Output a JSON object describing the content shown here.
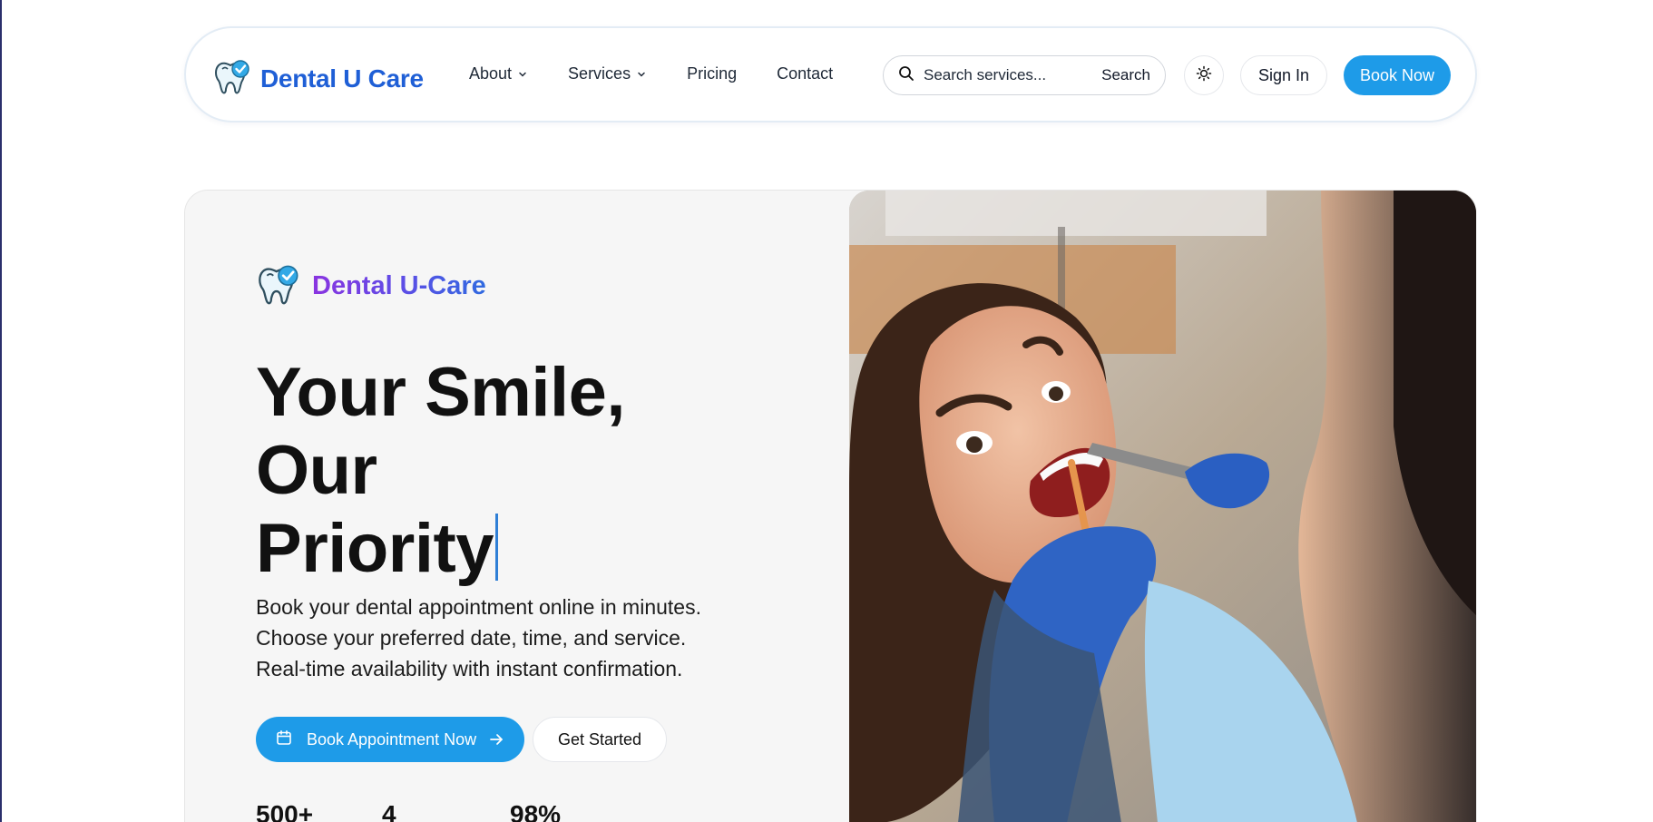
{
  "header": {
    "brand": "Dental U Care",
    "nav": [
      {
        "label": "About",
        "dropdown": true
      },
      {
        "label": "Services",
        "dropdown": true
      },
      {
        "label": "Pricing",
        "dropdown": false
      },
      {
        "label": "Contact",
        "dropdown": false
      }
    ],
    "search": {
      "placeholder": "Search services...",
      "button_label": "Search"
    },
    "theme_icon": "sun-icon",
    "signin_label": "Sign In",
    "book_label": "Book Now"
  },
  "hero": {
    "brand": "Dental U-Care",
    "title_line1": "Your Smile, Our",
    "title_line2": "Priority",
    "description": [
      "Book your dental appointment online in minutes.",
      "Choose your preferred date, time, and service.",
      "Real-time availability with instant confirmation."
    ],
    "primary_cta": "Book Appointment Now",
    "secondary_cta": "Get Started",
    "stats": [
      "500+",
      "4",
      "98%"
    ]
  },
  "colors": {
    "primary": "#1e9be8",
    "brand_blue": "#1f5fd6",
    "gradient_start": "#8a34e0",
    "gradient_end": "#2f6ae0"
  },
  "icons": {
    "logo": "tooth-check-icon",
    "search": "search-icon",
    "calendar": "calendar-icon",
    "arrow": "arrow-right-icon",
    "chevron": "chevron-down-icon"
  }
}
